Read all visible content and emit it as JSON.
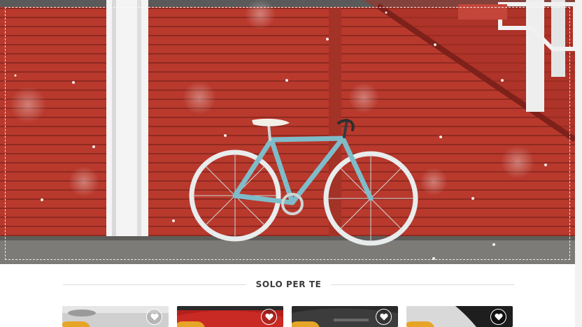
{
  "hero": {
    "image": "red-wall-bicycle-photo"
  },
  "section": {
    "title": "SOLO PER TE"
  },
  "cards": [
    {
      "thumb_color": "#cfcfcf",
      "icon": "heart-icon",
      "badge_color": "#e6a526"
    },
    {
      "thumb_color": "#b3201c",
      "icon": "heart-icon",
      "badge_color": "#e6a526"
    },
    {
      "thumb_color": "#2a2a2a",
      "icon": "heart-icon",
      "badge_color": "#e6a526"
    },
    {
      "thumb_color": "#d9d9d9",
      "icon": "heart-icon",
      "badge_color": "#e6a526"
    }
  ],
  "colors": {
    "accent": "#e6a526",
    "wall": "#b8382c",
    "heading": "#3a3a3a"
  }
}
